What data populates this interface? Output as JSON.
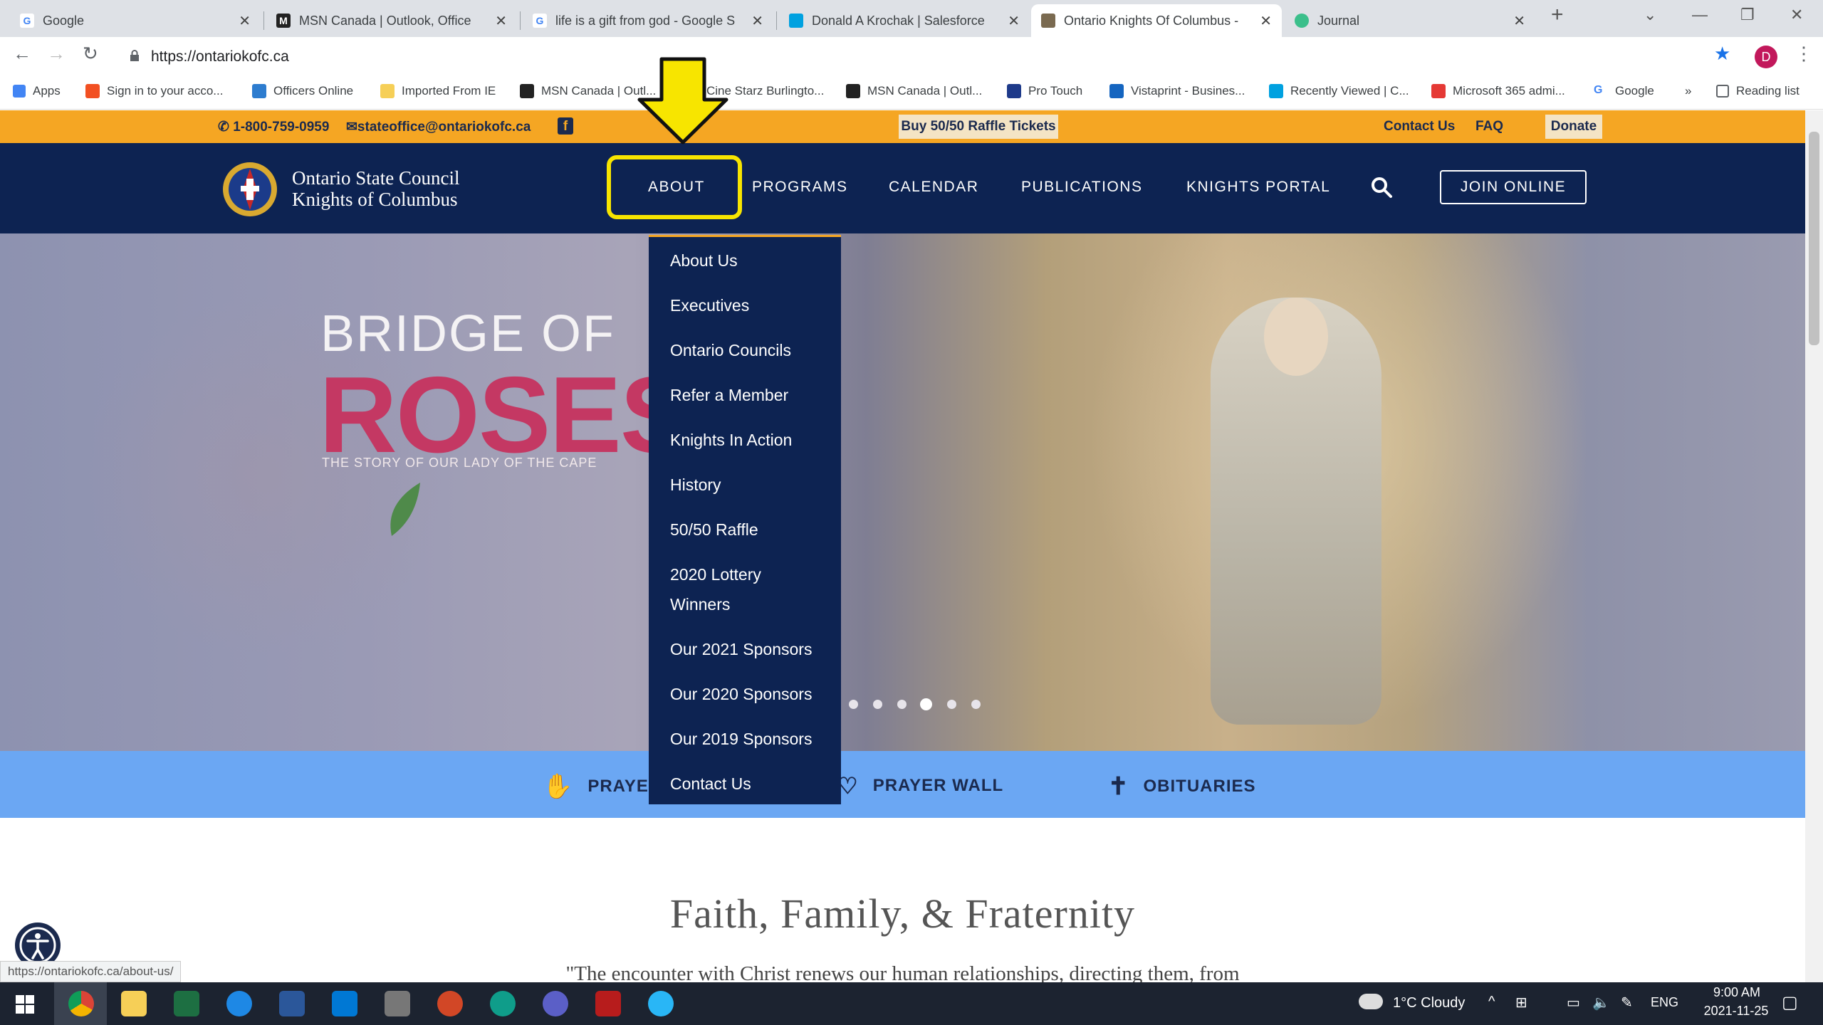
{
  "browser": {
    "tabs": [
      {
        "title": "Google",
        "favicon": "google-icon"
      },
      {
        "title": "MSN Canada | Outlook, Office",
        "favicon": "msn-icon"
      },
      {
        "title": "life is a gift from god - Google S",
        "favicon": "google-icon"
      },
      {
        "title": "Donald A Krochak | Salesforce",
        "favicon": "salesforce-icon"
      },
      {
        "title": "Ontario Knights Of Columbus -",
        "favicon": "kofc-icon"
      },
      {
        "title": "Journal",
        "favicon": "journal-icon"
      }
    ],
    "url": "https://ontariokofc.ca",
    "profile_initial": "D",
    "bookmarks": [
      "Apps",
      "Sign in to your acco...",
      "Officers Online",
      "Imported From IE",
      "MSN Canada | Outl...",
      "Cine Starz Burlingto...",
      "MSN Canada | Outl...",
      "Pro Touch",
      "Vistaprint - Busines...",
      "Recently Viewed | C...",
      "Microsoft 365 admi...",
      "Google",
      "»",
      "Reading list"
    ],
    "status_url": "https://ontariokofc.ca/about-us/"
  },
  "topstrip": {
    "phone": "1-800-759-0959",
    "email": "stateoffice@ontariokofc.ca",
    "raffle": "Buy 50/50 Raffle Tickets",
    "contact": "Contact Us",
    "faq": "FAQ",
    "donate": "Donate"
  },
  "nav": {
    "logo_line1": "Ontario State Council",
    "logo_line2": "Knights of Columbus",
    "items": [
      "ABOUT",
      "PROGRAMS",
      "CALENDAR",
      "PUBLICATIONS",
      "KNIGHTS PORTAL"
    ],
    "join": "JOIN ONLINE"
  },
  "dropdown": [
    "About Us",
    "Executives",
    "Ontario Councils",
    "Refer a Member",
    "Knights In Action",
    "History",
    "50/50 Raffle",
    "2020 Lottery",
    "Winners",
    "Our 2021 Sponsors",
    "Our 2020 Sponsors",
    "Our 2019 Sponsors",
    "Contact Us"
  ],
  "hero": {
    "line1": "BRIDGE OF",
    "line2": "ROSES",
    "tagline": "THE STORY OF OUR LADY OF THE CAPE"
  },
  "prayerbar": {
    "items": [
      "PRAYER",
      "PRAYER WALL",
      "OBITUARIES"
    ]
  },
  "content": {
    "heading": "Faith, Family, & Fraternity",
    "quote": "\"The encounter with Christ renews our human relationships, directing them, from"
  },
  "taskbar": {
    "weather": "1°C  Cloudy",
    "lang": "ENG",
    "time": "9:00 AM",
    "date": "2021-11-25"
  },
  "colors": {
    "navy": "#0d2352",
    "orange": "#f5a623",
    "highlight": "#f7e500",
    "prayer_bar": "#6ba7f3",
    "roses_pink": "#c43863"
  }
}
